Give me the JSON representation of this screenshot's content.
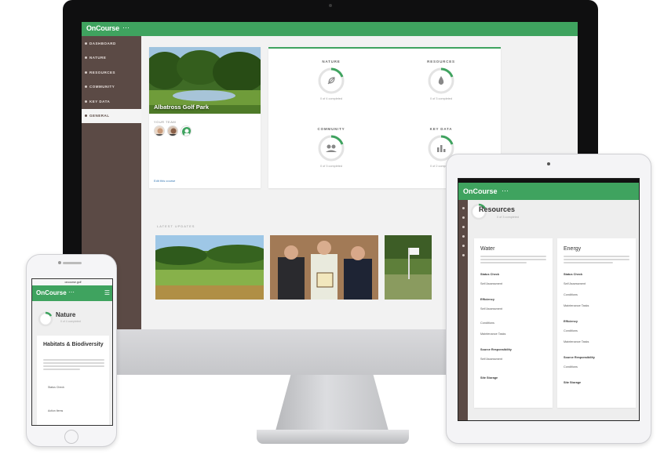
{
  "desktop": {
    "brand": "OnCourse",
    "brand_menu": "⋯",
    "sidebar": {
      "items": [
        {
          "label": "DASHBOARD"
        },
        {
          "label": "NATURE"
        },
        {
          "label": "RESOURCES"
        },
        {
          "label": "COMMUNITY"
        },
        {
          "label": "KEY DATA"
        },
        {
          "label": "GENERAL"
        }
      ]
    },
    "course": {
      "name": "Albatross Golf Park",
      "team_label": "YOUR TEAM",
      "link": "Edit this course"
    },
    "stats": [
      {
        "title": "NATURE",
        "sub": "0 of 4 completed"
      },
      {
        "title": "RESOURCES",
        "sub": "0 of 3 completed"
      },
      {
        "title": "COMMUNITY",
        "sub": "0 of 3 completed"
      },
      {
        "title": "KEY DATA",
        "sub": "0 of 2 completed"
      }
    ],
    "section_label": "LATEST UPDATES"
  },
  "tablet": {
    "brand": "OnCourse",
    "brand_menu": "⋯",
    "page_title": "Resources",
    "page_sub": "0 of 3 completed",
    "cards": [
      {
        "title": "Water",
        "items": [
          {
            "label": "Status Check",
            "type": "head"
          },
          {
            "label": "Self Assessment",
            "type": "item"
          },
          {
            "label": "Efficiency",
            "type": "head"
          },
          {
            "label": "Self Assessment",
            "type": "item"
          },
          {
            "label": "Conditions",
            "type": "item"
          },
          {
            "label": "Maintenance Tasks",
            "type": "item"
          },
          {
            "label": "Source Responsibility",
            "type": "head"
          },
          {
            "label": "Self Assessment",
            "type": "item"
          },
          {
            "label": "Site Storage",
            "type": "head"
          }
        ]
      },
      {
        "title": "Energy",
        "items": [
          {
            "label": "Status Check",
            "type": "head"
          },
          {
            "label": "Self Assessment",
            "type": "item"
          },
          {
            "label": "Conditions",
            "type": "item"
          },
          {
            "label": "Maintenance Tasks",
            "type": "item"
          },
          {
            "label": "Efficiency",
            "type": "head"
          },
          {
            "label": "Conditions",
            "type": "item"
          },
          {
            "label": "Maintenance Tasks",
            "type": "item"
          },
          {
            "label": "Source Responsibility",
            "type": "head"
          },
          {
            "label": "Conditions",
            "type": "item"
          },
          {
            "label": "Site Storage",
            "type": "head"
          }
        ]
      }
    ]
  },
  "phone": {
    "status_text": "oncourse.golf",
    "brand": "OnCourse",
    "brand_menu": "⋯",
    "menu_icon": "☰",
    "page_title": "Nature",
    "page_sub": "0 of 4 completed",
    "card_title": "Habitats & Biodiversity",
    "items": [
      {
        "label": "Status Check"
      },
      {
        "label": "Action Items"
      }
    ]
  },
  "colors": {
    "accent_green": "#3fa35f",
    "sidebar_brown": "#5b4a45"
  }
}
